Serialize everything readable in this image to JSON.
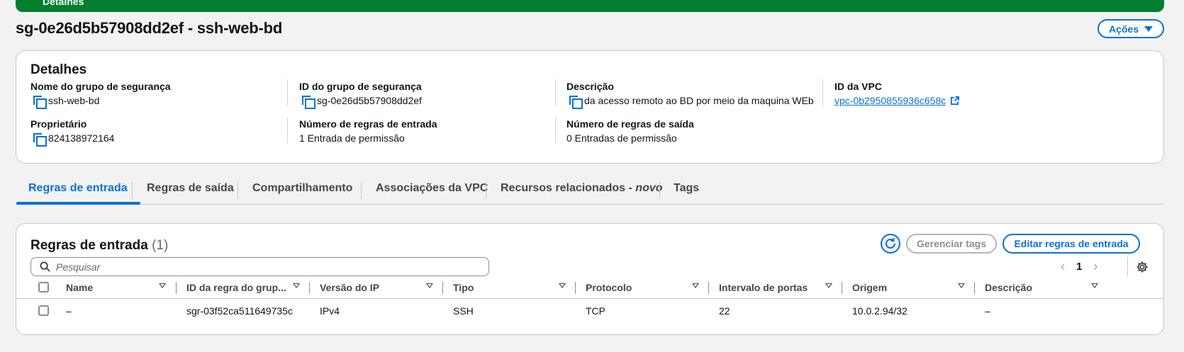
{
  "banner": {
    "label": "Detalhes"
  },
  "page": {
    "title": "sg-0e26d5b57908dd2ef - ssh-web-bd",
    "actions_label": "Ações"
  },
  "details": {
    "title": "Detalhes",
    "fields": {
      "name": {
        "label": "Nome do grupo de segurança",
        "value": "ssh-web-bd"
      },
      "group_id": {
        "label": "ID do grupo de segurança",
        "value": "sg-0e26d5b57908dd2ef"
      },
      "description": {
        "label": "Descrição",
        "value": "da acesso remoto ao BD por meio da maquina WEb"
      },
      "vpc_id": {
        "label": "ID da VPC",
        "value": "vpc-0b2950855936c658c"
      },
      "owner": {
        "label": "Proprietário",
        "value": "824138972164"
      },
      "inbound_count": {
        "label": "Número de regras de entrada",
        "value": "1 Entrada de permissão"
      },
      "outbound_count": {
        "label": "Número de regras de saída",
        "value": "0 Entradas de permissão"
      }
    }
  },
  "tabs": {
    "inbound": "Regras de entrada",
    "outbound": "Regras de saída",
    "sharing": "Compartilhamento",
    "vpc_assoc": "Associações da VPC",
    "related": "Recursos relacionados - ",
    "related_new": "novo",
    "tags": "Tags"
  },
  "rules": {
    "title": "Regras de entrada",
    "count": "(1)",
    "manage_tags_label": "Gerenciar tags",
    "edit_label": "Editar regras de entrada",
    "search_placeholder": "Pesquisar",
    "page_number": "1",
    "columns": {
      "name": "Name",
      "rule_id": "ID da regra do grup...",
      "ip_version": "Versão do IP",
      "type": "Tipo",
      "protocol": "Protocolo",
      "port_range": "Intervalo de portas",
      "source": "Origem",
      "description": "Descrição"
    },
    "rows": [
      {
        "name": "–",
        "rule_id": "sgr-03f52ca511649735c",
        "ip_version": "IPv4",
        "type": "SSH",
        "protocol": "TCP",
        "port_range": "22",
        "source": "10.0.2.94/32",
        "description": "–"
      }
    ]
  },
  "colors": {
    "accent": "#0972d3",
    "banner": "#037f2f"
  }
}
